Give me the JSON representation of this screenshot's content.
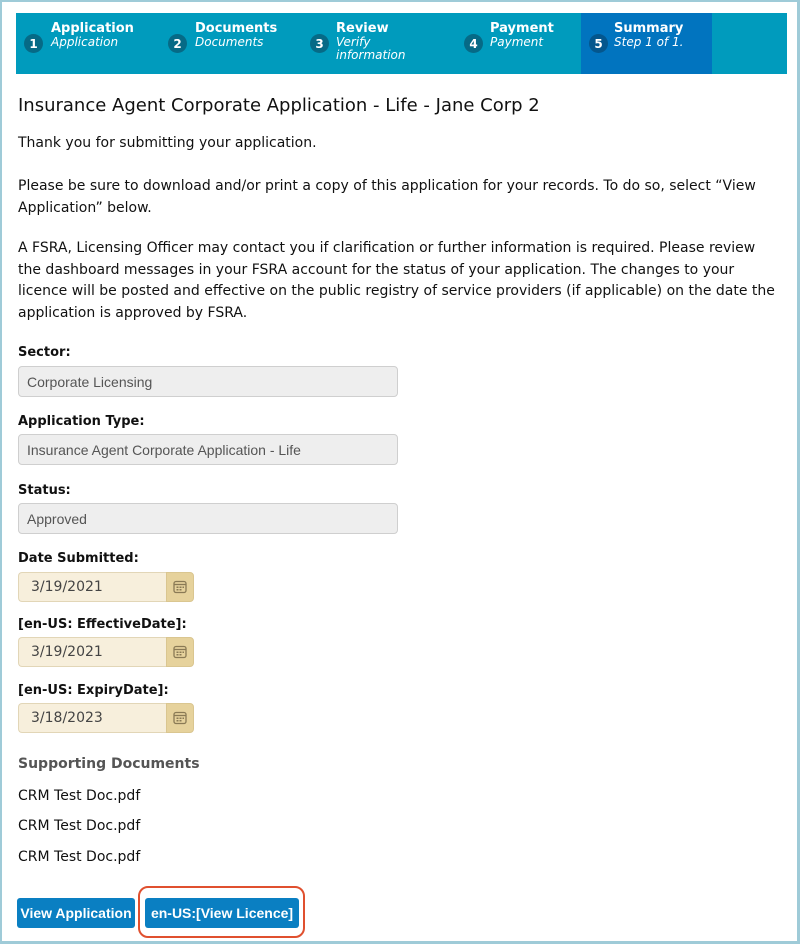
{
  "progress": {
    "steps": [
      {
        "number": "1",
        "title": "Application",
        "subtitle": "Application",
        "active": false
      },
      {
        "number": "2",
        "title": "Documents",
        "subtitle": "Documents",
        "active": false
      },
      {
        "number": "3",
        "title": "Review",
        "subtitle": "Verify information",
        "subtitle_line1": "Verify",
        "subtitle_line2": "information",
        "active": false
      },
      {
        "number": "4",
        "title": "Payment",
        "subtitle": "Payment",
        "active": false
      },
      {
        "number": "5",
        "title": "Summary",
        "subtitle": "Step 1 of 1.",
        "active": true
      }
    ],
    "colors": {
      "bar": "#009bbd",
      "active": "#0174bf"
    }
  },
  "page": {
    "title": "Insurance Agent Corporate Application - Life - Jane Corp 2",
    "paragraphs": [
      "Thank you for submitting your application.",
      "Please be sure to download and/or print a copy of this application for your records. To do so, select “View Application” below.",
      "A FSRA, Licensing Officer may contact you if clarification or further information is required. Please review the dashboard messages in your FSRA account for the status of your application. The changes to your licence will be posted and effective on the public registry of service providers (if applicable) on the date the application is approved by FSRA."
    ]
  },
  "fields": {
    "sector": {
      "label": "Sector:",
      "value": "Corporate Licensing"
    },
    "application_type": {
      "label": "Application Type:",
      "value": "Insurance Agent Corporate Application - Life"
    },
    "status": {
      "label": "Status:",
      "value": "Approved"
    },
    "date_submitted": {
      "label": "Date Submitted:",
      "value": "3/19/2021",
      "icon": "calendar-icon"
    },
    "effective_date": {
      "label": "[en-US: EffectiveDate]:",
      "value": "3/19/2021",
      "icon": "calendar-icon"
    },
    "expiry_date": {
      "label": "[en-US: ExpiryDate]:",
      "value": "3/18/2023",
      "icon": "calendar-icon"
    }
  },
  "supporting_documents": {
    "title": "Supporting Documents",
    "items": [
      "CRM Test Doc.pdf",
      "CRM Test Doc.pdf",
      "CRM Test Doc.pdf"
    ]
  },
  "actions": {
    "view_application": "View Application",
    "view_licence": "en-US:[View Licence]",
    "button_color": "#0a7fc2",
    "highlight_color": "#e0502f"
  }
}
